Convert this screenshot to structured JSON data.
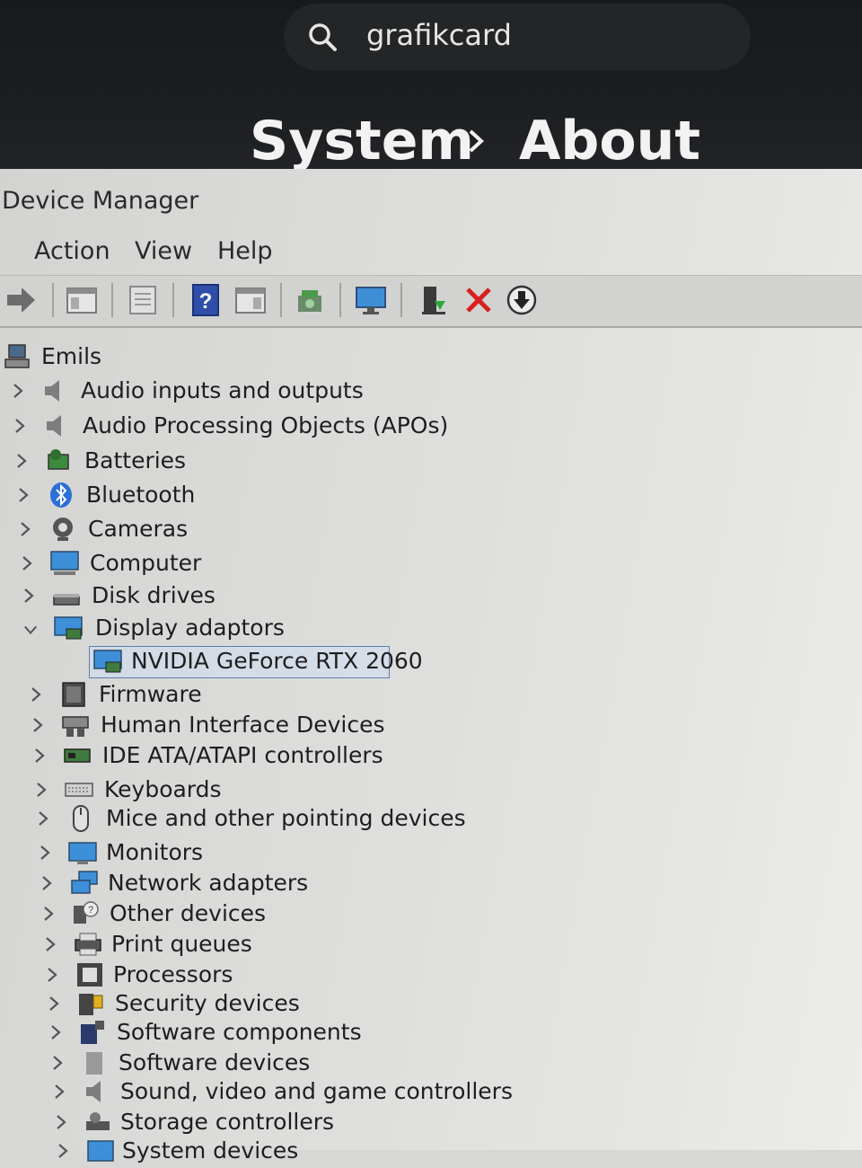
{
  "settings": {
    "search_value": "grafikcard",
    "breadcrumb": [
      "System",
      "About"
    ]
  },
  "window": {
    "title": "Device Manager",
    "menu": [
      "Action",
      "View",
      "Help"
    ]
  },
  "toolbar_icons": [
    "back-arrow-icon",
    "show-hide-console-tree-icon",
    "properties-icon",
    "help-icon",
    "action-pane-icon",
    "update-driver-icon",
    "monitor-icon",
    "enable-device-icon",
    "uninstall-device-icon",
    "scan-for-hardware-changes-icon"
  ],
  "tree": {
    "root": "Emils",
    "categories": [
      {
        "label": "Audio inputs and outputs",
        "icon": "speaker-icon"
      },
      {
        "label": "Audio Processing Objects (APOs)",
        "icon": "speaker-icon"
      },
      {
        "label": "Batteries",
        "icon": "battery-icon"
      },
      {
        "label": "Bluetooth",
        "icon": "bluetooth-icon"
      },
      {
        "label": "Cameras",
        "icon": "camera-icon"
      },
      {
        "label": "Computer",
        "icon": "computer-icon"
      },
      {
        "label": "Disk drives",
        "icon": "disk-drive-icon"
      },
      {
        "label": "Display adaptors",
        "icon": "display-adapter-icon",
        "expanded": true,
        "children": [
          {
            "label": "NVIDIA GeForce RTX 2060",
            "icon": "display-adapter-icon",
            "selected": true
          }
        ]
      },
      {
        "label": "Firmware",
        "icon": "firmware-icon"
      },
      {
        "label": "Human Interface Devices",
        "icon": "hid-icon"
      },
      {
        "label": "IDE ATA/ATAPI controllers",
        "icon": "ide-controller-icon"
      },
      {
        "label": "Keyboards",
        "icon": "keyboard-icon"
      },
      {
        "label": "Mice and other pointing devices",
        "icon": "mouse-icon"
      },
      {
        "label": "Monitors",
        "icon": "monitor-icon"
      },
      {
        "label": "Network adapters",
        "icon": "network-adapter-icon"
      },
      {
        "label": "Other devices",
        "icon": "unknown-device-icon"
      },
      {
        "label": "Print queues",
        "icon": "printer-icon"
      },
      {
        "label": "Processors",
        "icon": "processor-icon"
      },
      {
        "label": "Security devices",
        "icon": "security-device-icon"
      },
      {
        "label": "Software components",
        "icon": "software-component-icon"
      },
      {
        "label": "Software devices",
        "icon": "software-device-icon"
      },
      {
        "label": "Sound, video and game controllers",
        "icon": "sound-icon"
      },
      {
        "label": "Storage controllers",
        "icon": "storage-controller-icon"
      },
      {
        "label": "System devices",
        "icon": "system-devices-icon"
      }
    ]
  }
}
